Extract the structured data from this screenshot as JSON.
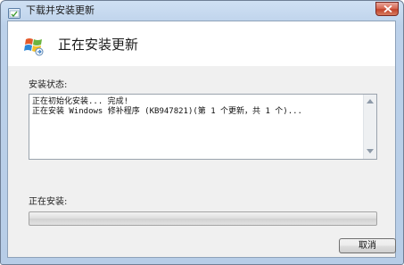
{
  "window": {
    "title": "下载并安装更新"
  },
  "header": {
    "title": "正在安装更新"
  },
  "status": {
    "label": "安装状态:",
    "lines": [
      "正在初始化安装... 完成!",
      "正在安装 Windows 修补程序 (KB947821)(第 1 个更新，共 1 个)..."
    ]
  },
  "progress": {
    "label": "正在安装:",
    "value_percent": 0
  },
  "buttons": {
    "cancel": "取消"
  },
  "colors": {
    "accent": "#3da22d",
    "close": "#c2432b"
  }
}
